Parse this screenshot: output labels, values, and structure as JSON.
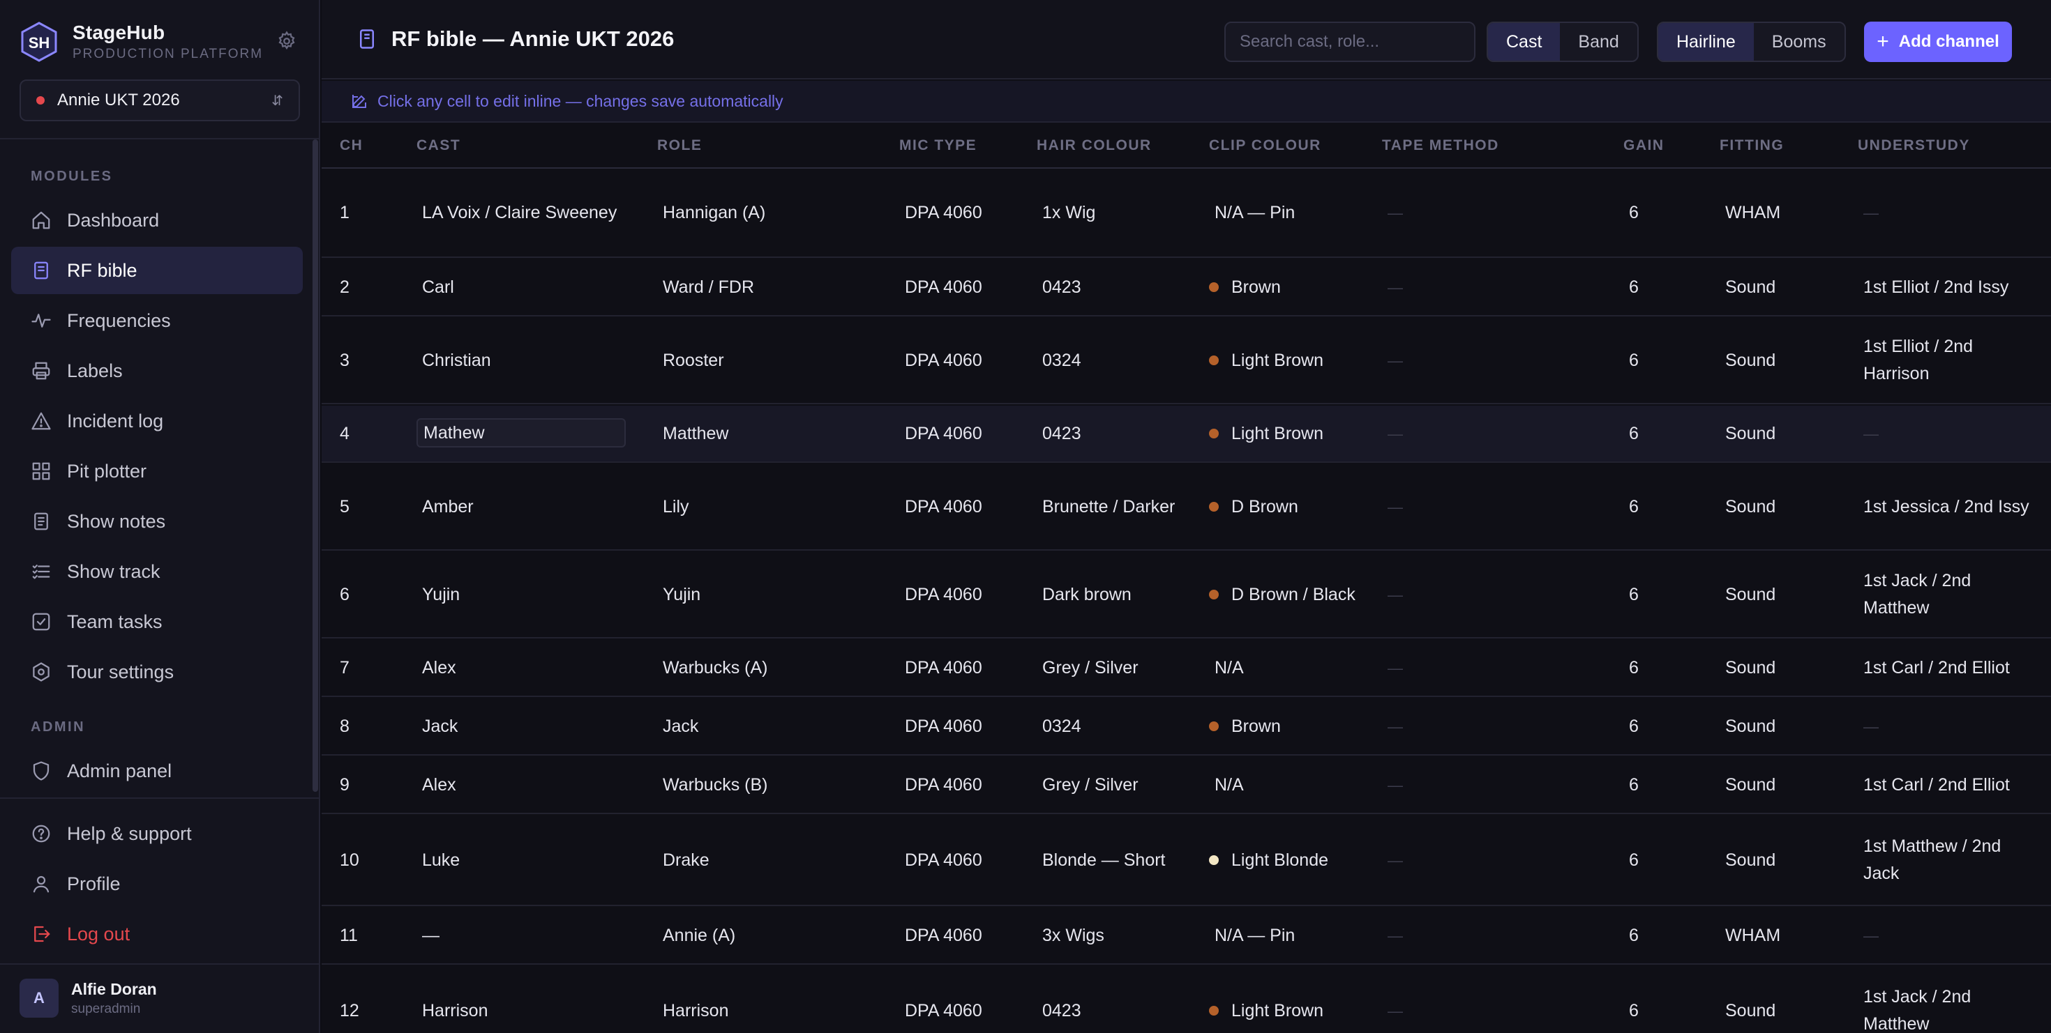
{
  "sidebar": {
    "brand_name": "StageHub",
    "brand_sub": "PRODUCTION PLATFORM",
    "logo_letters": "SH",
    "production": "Annie UKT 2026",
    "modules_label": "MODULES",
    "admin_label": "ADMIN",
    "modules": [
      {
        "label": "Dashboard",
        "icon": "home-icon",
        "active": false
      },
      {
        "label": "RF bible",
        "icon": "book-icon",
        "active": true
      },
      {
        "label": "Frequencies",
        "icon": "pulse-icon",
        "active": false
      },
      {
        "label": "Labels",
        "icon": "printer-icon",
        "active": false
      },
      {
        "label": "Incident log",
        "icon": "warning-icon",
        "active": false
      },
      {
        "label": "Pit plotter",
        "icon": "grid-icon",
        "active": false
      },
      {
        "label": "Show notes",
        "icon": "notes-icon",
        "active": false
      },
      {
        "label": "Show track",
        "icon": "list-icon",
        "active": false
      },
      {
        "label": "Team tasks",
        "icon": "check-square-icon",
        "active": false
      },
      {
        "label": "Tour settings",
        "icon": "settings-icon",
        "active": false
      }
    ],
    "admin": [
      {
        "label": "Admin panel",
        "icon": "shield-icon"
      }
    ],
    "footer": [
      {
        "label": "Help & support",
        "icon": "help-icon"
      },
      {
        "label": "Profile",
        "icon": "user-icon"
      },
      {
        "label": "Log out",
        "icon": "logout-icon"
      }
    ],
    "user": {
      "initial": "A",
      "name": "Alfie Doran",
      "role": "superadmin"
    }
  },
  "header": {
    "title": "RF bible — Annie UKT 2026",
    "search_placeholder": "Search cast, role...",
    "view_toggle": [
      "Cast",
      "Band"
    ],
    "view_selected": "Cast",
    "mount_toggle": [
      "Hairline",
      "Booms"
    ],
    "mount_selected": "Hairline",
    "add_label": "Add channel"
  },
  "hint": "Click any cell to edit inline — changes save automatically",
  "colors": {
    "accent": "#6c63ff",
    "brown": "#b5612a",
    "light_blonde": "#f3e6c4",
    "danger": "#e5484d"
  },
  "table": {
    "columns": [
      "CH",
      "CAST",
      "ROLE",
      "MIC TYPE",
      "HAIR COLOUR",
      "CLIP COLOUR",
      "TAPE METHOD",
      "GAIN",
      "FITTING",
      "UNDERSTUDY"
    ],
    "rows": [
      {
        "ch": "1",
        "cast": "LA Voix / Claire Sweeney",
        "role": "Hannigan (A)",
        "mic": "DPA 4060",
        "hair": "1x Wig",
        "clip": "N/A — Pin",
        "clip_color": "",
        "tape": "—",
        "gain": "6",
        "fitting": "WHAM",
        "understudy": "—"
      },
      {
        "ch": "2",
        "cast": "Carl",
        "role": "Ward / FDR",
        "mic": "DPA 4060",
        "hair": "0423",
        "clip": "Brown",
        "clip_color": "#b5612a",
        "tape": "—",
        "gain": "6",
        "fitting": "Sound",
        "understudy": "1st Elliot / 2nd Issy"
      },
      {
        "ch": "3",
        "cast": "Christian",
        "role": "Rooster",
        "mic": "DPA 4060",
        "hair": "0324",
        "clip": "Light Brown",
        "clip_color": "#b5612a",
        "tape": "—",
        "gain": "6",
        "fitting": "Sound",
        "understudy": "1st Elliot / 2nd Harrison"
      },
      {
        "ch": "4",
        "cast": "Mathew",
        "role": "Matthew",
        "mic": "DPA 4060",
        "hair": "0423",
        "clip": "Light Brown",
        "clip_color": "#b5612a",
        "tape": "—",
        "gain": "6",
        "fitting": "Sound",
        "understudy": "—"
      },
      {
        "ch": "5",
        "cast": "Amber",
        "role": "Lily",
        "mic": "DPA 4060",
        "hair": "Brunette / Darker",
        "clip": "D Brown",
        "clip_color": "#b5612a",
        "tape": "—",
        "gain": "6",
        "fitting": "Sound",
        "understudy": "1st Jessica / 2nd Issy"
      },
      {
        "ch": "6",
        "cast": "Yujin",
        "role": "Yujin",
        "mic": "DPA 4060",
        "hair": "Dark brown",
        "clip": "D Brown / Black",
        "clip_color": "#b5612a",
        "tape": "—",
        "gain": "6",
        "fitting": "Sound",
        "understudy": "1st Jack / 2nd Matthew"
      },
      {
        "ch": "7",
        "cast": "Alex",
        "role": "Warbucks (A)",
        "mic": "DPA 4060",
        "hair": "Grey / Silver",
        "clip": "N/A",
        "clip_color": "",
        "tape": "—",
        "gain": "6",
        "fitting": "Sound",
        "understudy": "1st Carl / 2nd Elliot"
      },
      {
        "ch": "8",
        "cast": "Jack",
        "role": "Jack",
        "mic": "DPA 4060",
        "hair": "0324",
        "clip": "Brown",
        "clip_color": "#b5612a",
        "tape": "—",
        "gain": "6",
        "fitting": "Sound",
        "understudy": "—"
      },
      {
        "ch": "9",
        "cast": "Alex",
        "role": "Warbucks (B)",
        "mic": "DPA 4060",
        "hair": "Grey / Silver",
        "clip": "N/A",
        "clip_color": "",
        "tape": "—",
        "gain": "6",
        "fitting": "Sound",
        "understudy": "1st Carl / 2nd Elliot"
      },
      {
        "ch": "10",
        "cast": "Luke",
        "role": "Drake",
        "mic": "DPA 4060",
        "hair": "Blonde — Short",
        "clip": "Light Blonde",
        "clip_color": "#f3e6c4",
        "tape": "—",
        "gain": "6",
        "fitting": "Sound",
        "understudy": "1st Matthew / 2nd Jack"
      },
      {
        "ch": "11",
        "cast": "—",
        "role": "Annie (A)",
        "mic": "DPA 4060",
        "hair": "3x Wigs",
        "clip": "N/A — Pin",
        "clip_color": "",
        "tape": "—",
        "gain": "6",
        "fitting": "WHAM",
        "understudy": "—"
      },
      {
        "ch": "12",
        "cast": "Harrison",
        "role": "Harrison",
        "mic": "DPA 4060",
        "hair": "0423",
        "clip": "Light Brown",
        "clip_color": "#b5612a",
        "tape": "—",
        "gain": "6",
        "fitting": "Sound",
        "understudy": "1st Jack / 2nd Matthew"
      }
    ]
  }
}
